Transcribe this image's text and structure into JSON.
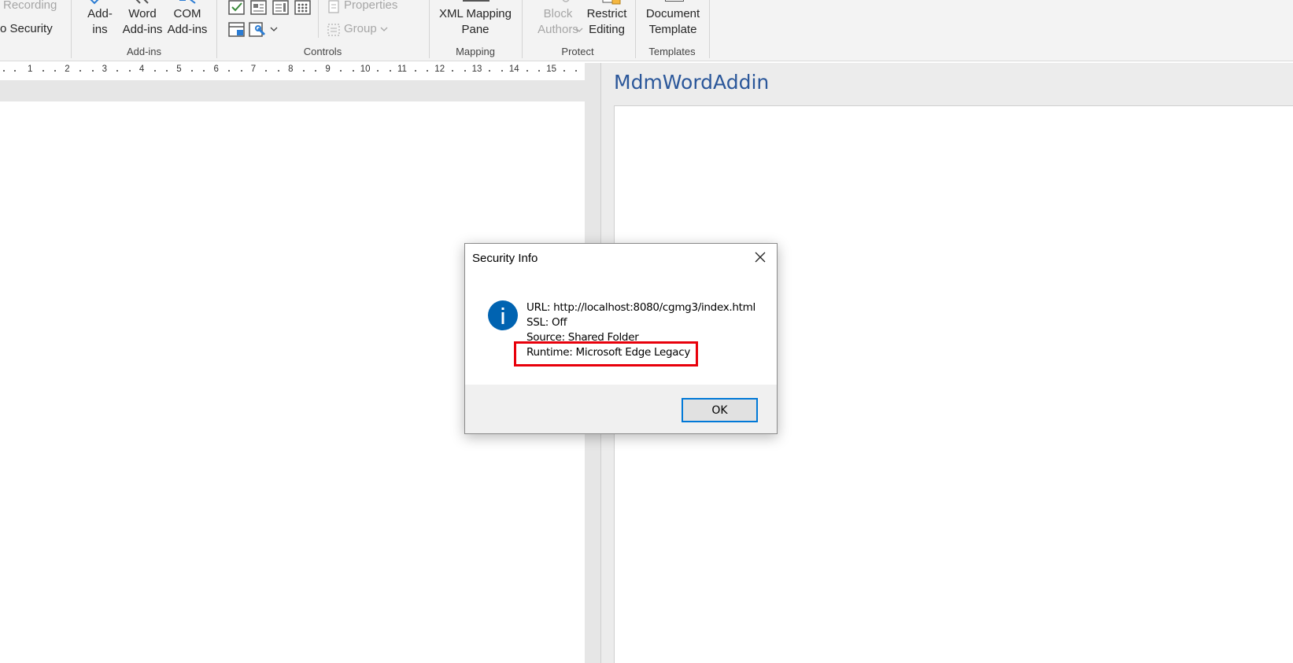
{
  "ribbon": {
    "code_group": {
      "recording_label": "Recording",
      "security_label": "o Security"
    },
    "addins_group": {
      "addins_label_1": "Add-",
      "addins_label_2": "ins",
      "word_addins_label_1": "Word",
      "word_addins_label_2": "Add-ins",
      "com_addins_label_1": "COM",
      "com_addins_label_2": "Add-ins",
      "group_label": "Add-ins"
    },
    "controls_group": {
      "properties_label": "Properties",
      "group_button_label": "Group",
      "group_label": "Controls"
    },
    "mapping_group": {
      "xml_label_1": "XML Mapping",
      "xml_label_2": "Pane",
      "group_label": "Mapping"
    },
    "protect_group": {
      "block_label_1": "Block",
      "block_label_2": "Authors",
      "restrict_label_1": "Restrict",
      "restrict_label_2": "Editing",
      "group_label": "Protect"
    },
    "templates_group": {
      "doc_template_label_1": "Document",
      "doc_template_label_2": "Template",
      "group_label": "Templates"
    }
  },
  "ruler": {
    "ticks": [
      "1",
      "2",
      "3",
      "4",
      "5",
      "6",
      "7",
      "8",
      "9",
      "10",
      "11",
      "12",
      "13",
      "14",
      "15"
    ]
  },
  "task_pane": {
    "title": "MdmWordAddin"
  },
  "dialog": {
    "title": "Security Info",
    "lines": {
      "url": "URL: http://localhost:8080/cgmg3/index.html",
      "ssl": "SSL: Off",
      "source": "Source: Shared Folder",
      "runtime": "Runtime: Microsoft Edge Legacy"
    },
    "ok_label": "OK",
    "highlight_color": "#e8000b",
    "info_icon_color": "#0063b1"
  }
}
